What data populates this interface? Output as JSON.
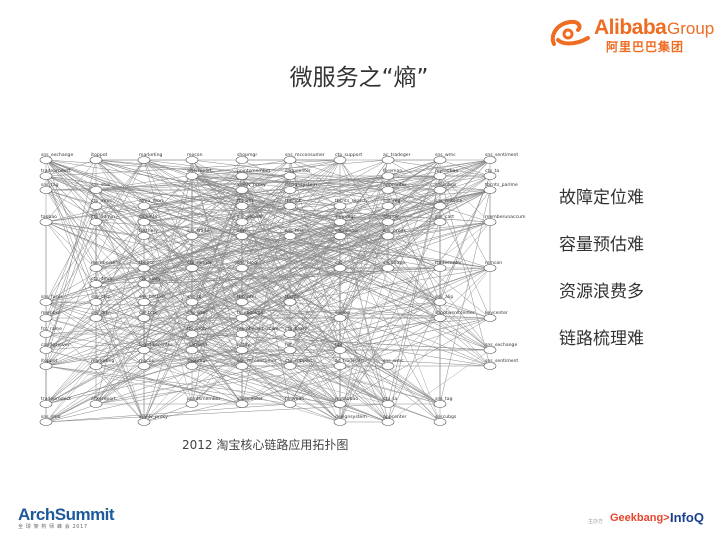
{
  "brand": {
    "wordmark": "Alibaba",
    "group": "Group",
    "cn": "阿里巴巴集团",
    "color": "#ef6c23"
  },
  "slide": {
    "title": "微服务之“熵”"
  },
  "diagram": {
    "caption": "2012 淘宝核心链路应用拓扑图",
    "node_labels": [
      "sns_exchange",
      "itoppot",
      "marketing",
      "mocon",
      "shopmgr",
      "sns_mcconsumer",
      "ctp_support",
      "ac_tradeger",
      "sns_wmc",
      "sns_sentiment",
      "tradeproduct",
      "afterreport",
      "pointsmember",
      "shopcenter",
      "foreman",
      "mytaobao",
      "ctp_ta",
      "sns_tag",
      "sns_shar",
      "xianlv_proxy",
      "designsystem",
      "appcenter",
      "snscubgs",
      "tbcnts_parlme",
      "ctp_mmc",
      "alma_mon",
      "fbpoint",
      "tbsclot",
      "tbcnts_search",
      "sns_mg",
      "sns_mission",
      "taobao",
      "ctp_admin",
      "cnaiinfo",
      "sns_sebedl",
      "shopmgr",
      "stepdir",
      "sns_cart",
      "memberunaccum",
      "fusthery",
      "sns_trade",
      "crm",
      "sns_test",
      "snsnunner",
      "sns_prods",
      "memberslink",
      "tbopsc",
      "ctp_ranger",
      "sns_blog",
      "cat",
      "shcodapp",
      "tradecenter",
      "mmcon",
      "ctp_dmm",
      "ctp_nowy",
      "sns_fuser",
      "sns_ctsp",
      "sns_bsclass",
      "sns_dl",
      "tbcenter",
      "tbcnts",
      "sns_alip",
      "member",
      "sns_drp",
      "cni_tctx",
      "sns_wtec",
      "tc_ebookgor",
      "snslog",
      "shoptwsnitcenter",
      "keycenter",
      "fcc_rame",
      "tbcppoly",
      "membersubsrcam",
      "ctp_brost",
      "configserver",
      "logisticscenter",
      "diamond",
      "notify",
      "hsf",
      "tair"
    ]
  },
  "bullets": [
    "故障定位难",
    "容量预估难",
    "资源浪费多",
    "链路梳理难"
  ],
  "footer": {
    "archsummit": "ArchSummit",
    "archsummit_sub": "全 球 架 构 师 峰 会 2017",
    "sponsor_small": "主办方",
    "geekbang": "Geekbang>.",
    "infoq": "InfoQ"
  }
}
